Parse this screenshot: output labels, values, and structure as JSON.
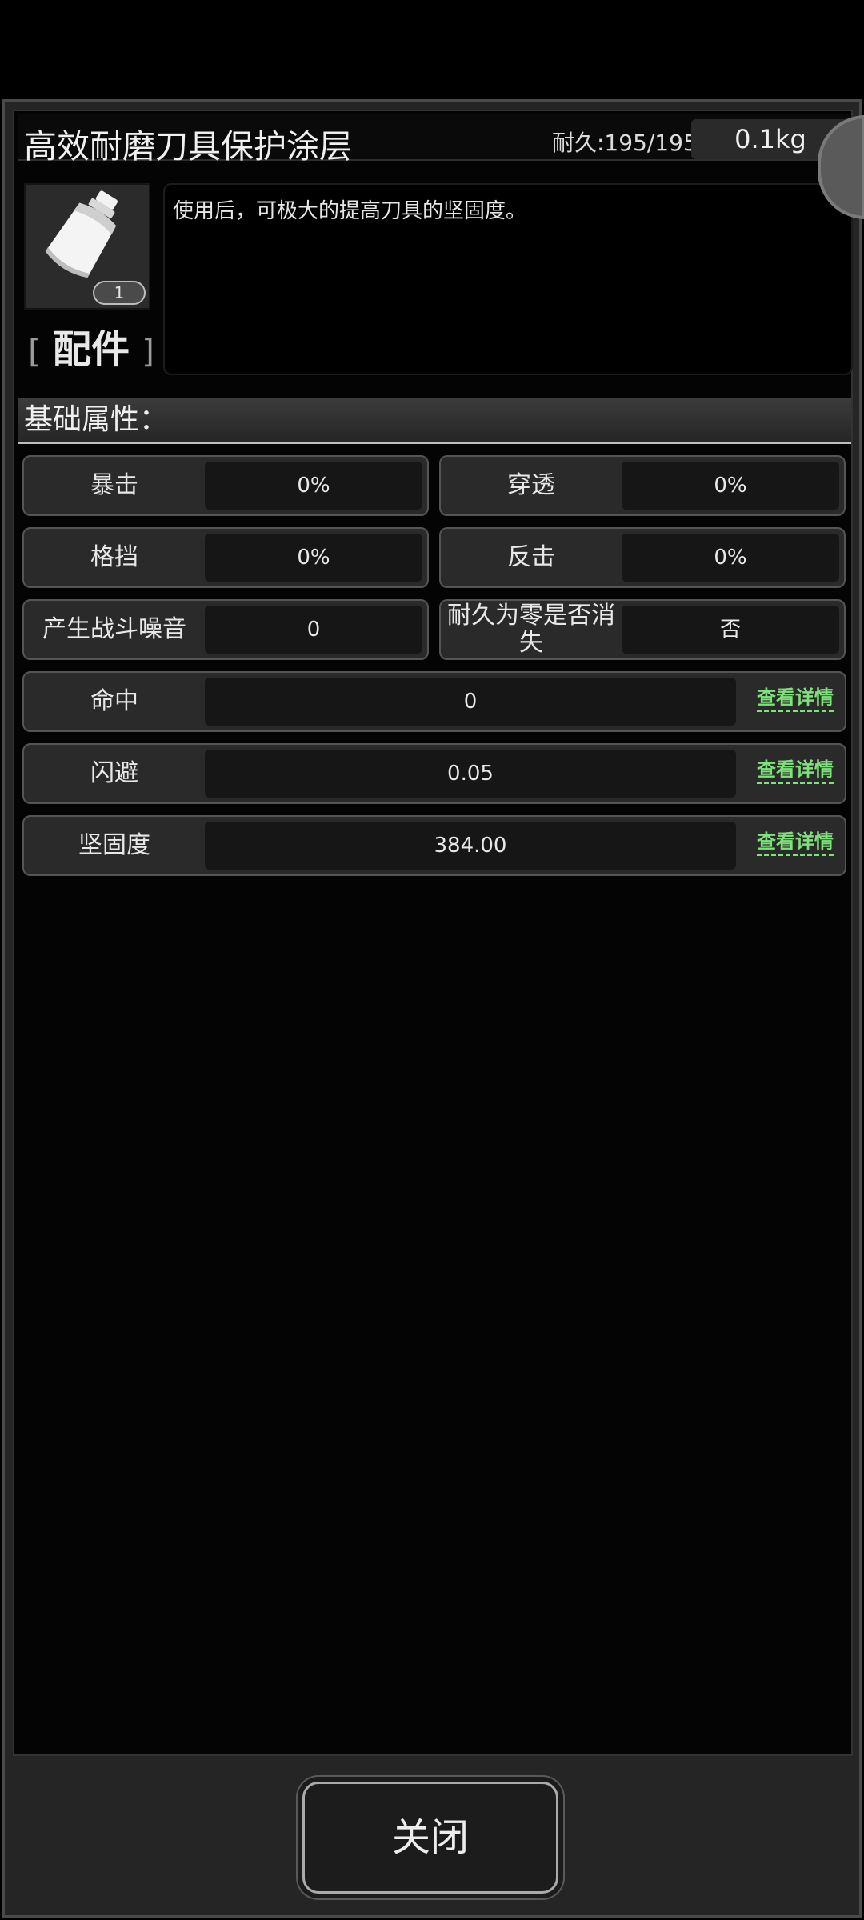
{
  "item": {
    "name": "高效耐磨刀具保护涂层",
    "durability": "耐久:195/195",
    "weight": "0.1kg",
    "count_badge": "1",
    "category_left": "[",
    "category": "配件",
    "category_right": "]",
    "description": "使用后，可极大的提高刀具的坚固度。",
    "icon": "spray-can-icon"
  },
  "section": {
    "title": "基础属性："
  },
  "attributes": {
    "crit": {
      "label": "暴击",
      "value": "0%"
    },
    "pierce": {
      "label": "穿透",
      "value": "0%"
    },
    "block": {
      "label": "格挡",
      "value": "0%"
    },
    "counter": {
      "label": "反击",
      "value": "0%"
    },
    "noise": {
      "label": "产生战斗噪音",
      "value": "0"
    },
    "vanish": {
      "label": "耐久为零是否消失",
      "value": "否"
    },
    "hit": {
      "label": "命中",
      "value": "0",
      "link": "查看详情"
    },
    "dodge": {
      "label": "闪避",
      "value": "0.05",
      "link": "查看详情"
    },
    "firmness": {
      "label": "坚固度",
      "value": "384.00",
      "link": "查看详情"
    }
  },
  "footer": {
    "close_label": "关闭"
  },
  "colors": {
    "link_green": "#7ee27a",
    "panel_bg": "#252525"
  }
}
